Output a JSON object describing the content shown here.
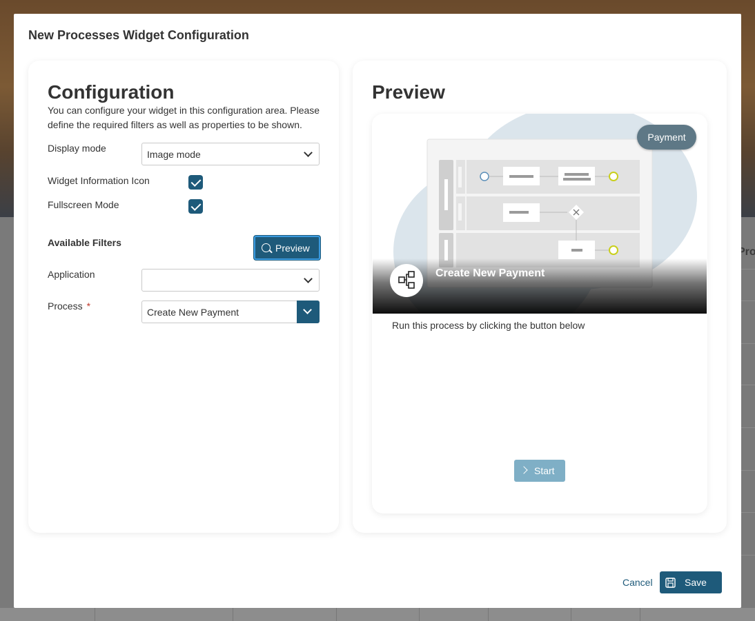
{
  "modal": {
    "title": "New Processes Widget Configuration"
  },
  "config": {
    "heading": "Configuration",
    "description": "You can configure your widget in this configuration area. Please define the required filters as well as properties to be shown.",
    "display_mode": {
      "label": "Display mode",
      "value": "Image mode"
    },
    "info_icon": {
      "label": "Widget Information Icon",
      "checked": true
    },
    "fullscreen": {
      "label": "Fullscreen Mode",
      "checked": true
    },
    "filters": {
      "label": "Available Filters",
      "preview_button": "Preview"
    },
    "application": {
      "label": "Application",
      "value": ""
    },
    "process": {
      "label": "Process",
      "required_mark": "*",
      "value": "Create New Payment"
    }
  },
  "preview": {
    "heading": "Preview",
    "card": {
      "badge": "Payment",
      "title": "Create New Payment",
      "description": "Run this process by clicking the button below",
      "start_button": "Start"
    }
  },
  "footer": {
    "cancel": "Cancel",
    "save": "Save"
  },
  "background": {
    "partial_text": "Pro"
  },
  "colors": {
    "primary": "#1e5a7a",
    "focus_ring": "#3b9be0",
    "badge": "#5e7886",
    "start_button": "#7fafc6",
    "required": "#c0392b"
  }
}
